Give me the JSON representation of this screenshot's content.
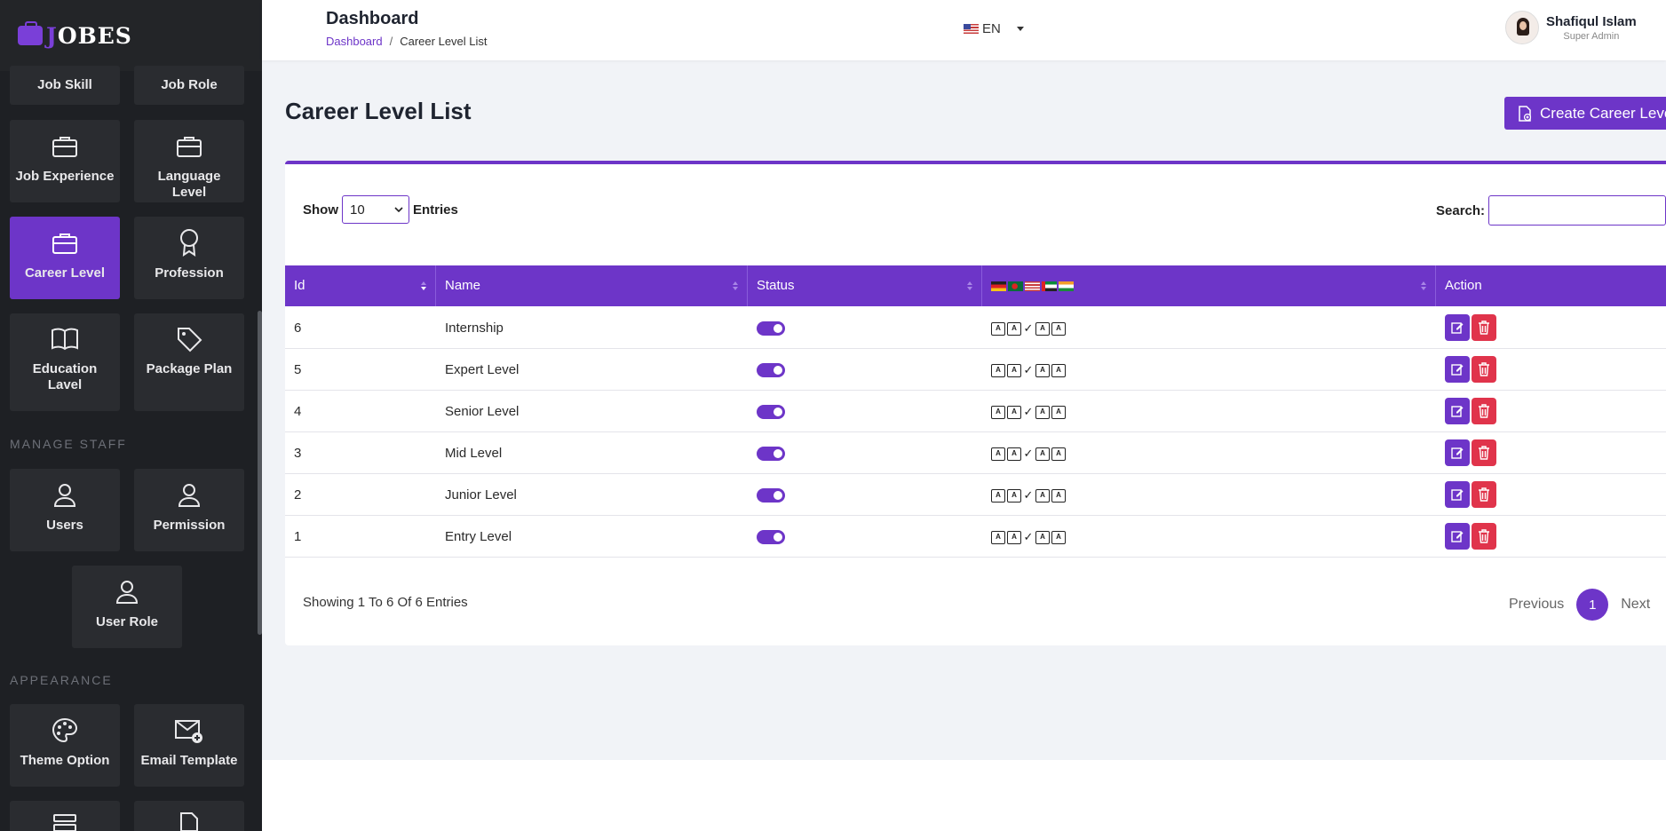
{
  "app": {
    "brand_first": "J",
    "brand_rest": "OBES"
  },
  "sidebar": {
    "tiles": [
      {
        "label": "Job Skill",
        "icon": "briefcase-icon"
      },
      {
        "label": "Job Role",
        "icon": "briefcase-icon"
      },
      {
        "label": "Job Experience",
        "icon": "briefcase-icon"
      },
      {
        "label": "Language Level",
        "icon": "briefcase-icon"
      },
      {
        "label": "Career Level",
        "icon": "briefcase-icon",
        "active": true
      },
      {
        "label": "Profession",
        "icon": "award-icon"
      },
      {
        "label": "Education Lavel",
        "icon": "book-icon"
      },
      {
        "label": "Package Plan",
        "icon": "tag-icon"
      }
    ],
    "manage_staff_heading": "MANAGE STAFF",
    "staff_tiles": [
      {
        "label": "Users",
        "icon": "user-icon"
      },
      {
        "label": "Permission",
        "icon": "user-icon"
      },
      {
        "label": "User Role",
        "icon": "user-icon"
      }
    ],
    "appearance_heading": "APPEARANCE",
    "appearance_tiles": [
      {
        "label": "Theme Option",
        "icon": "palette-icon"
      },
      {
        "label": "Email Template",
        "icon": "mail-plus-icon"
      }
    ]
  },
  "header": {
    "title": "Dashboard",
    "breadcrumb": {
      "link": "Dashboard",
      "separator": "/",
      "current": "Career Level List"
    },
    "language": "EN",
    "user": {
      "name": "Shafiqul Islam",
      "role": "Super Admin"
    }
  },
  "main": {
    "title": "Career Level List",
    "create_button": "Create Career Level",
    "show_label": "Show",
    "entries_label": "Entries",
    "page_size": "10",
    "search_label": "Search:",
    "search_value": "",
    "columns": {
      "id": "Id",
      "name": "Name",
      "status": "Status",
      "action": "Action"
    },
    "rows": [
      {
        "id": "6",
        "name": "Internship",
        "status": true
      },
      {
        "id": "5",
        "name": "Expert Level",
        "status": true
      },
      {
        "id": "4",
        "name": "Senior Level",
        "status": true
      },
      {
        "id": "3",
        "name": "Mid Level",
        "status": true
      },
      {
        "id": "2",
        "name": "Junior Level",
        "status": true
      },
      {
        "id": "1",
        "name": "Entry Level",
        "status": true
      }
    ],
    "footer_info": "Showing 1 To 6 Of 6 Entries",
    "pagination": {
      "previous": "Previous",
      "current": "1",
      "next": "Next"
    }
  },
  "colors": {
    "accent": "#6d35c8",
    "danger": "#e0344b",
    "sidebar_bg": "#1e2024"
  }
}
